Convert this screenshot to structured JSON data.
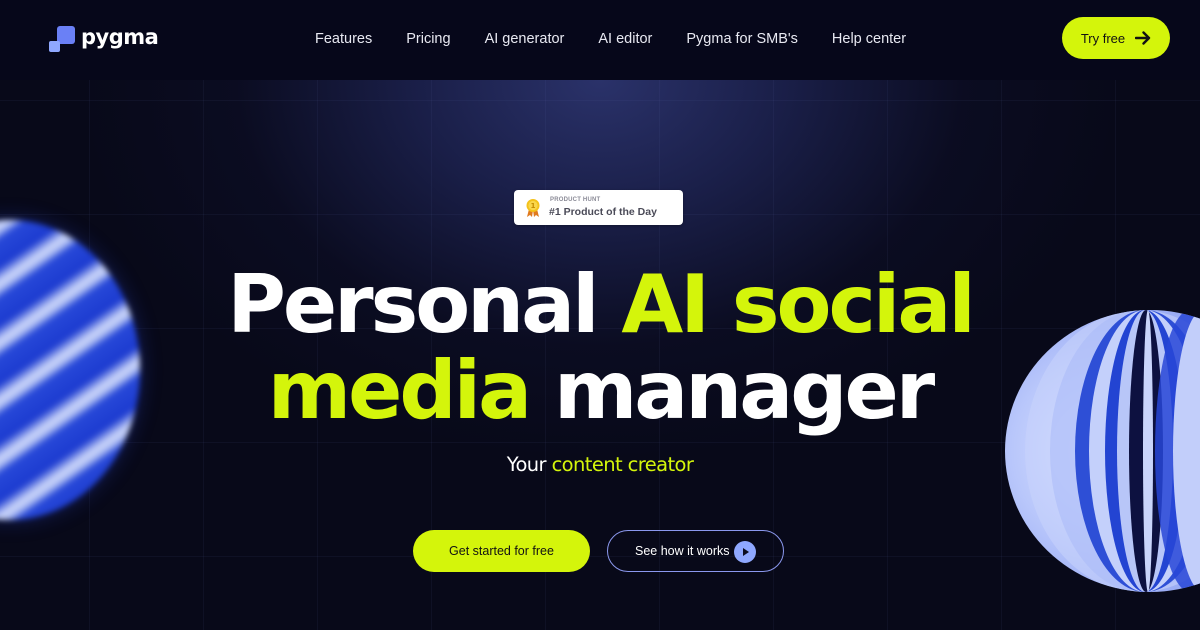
{
  "header": {
    "logo_text": "pygma",
    "nav": [
      {
        "label": "Features"
      },
      {
        "label": "Pricing"
      },
      {
        "label": "AI generator"
      },
      {
        "label": "AI editor"
      },
      {
        "label": "Pygma for SMB's"
      },
      {
        "label": "Help center"
      }
    ],
    "cta_label": "Try free",
    "cta_icon": "arrow-right-icon"
  },
  "badge": {
    "eyebrow": "PRODUCT HUNT",
    "title": "#1 Product of the Day",
    "icon": "medal-icon"
  },
  "hero": {
    "headline_line1_white": "Personal",
    "headline_line1_accent": "AI social",
    "headline_line2_accent": "media",
    "headline_line2_white": "manager",
    "subtitle_white": "Your",
    "subtitle_accent": "content creator",
    "primary_cta": "Get started for free",
    "secondary_cta": "See how it works",
    "secondary_cta_icon": "play-icon"
  },
  "colors": {
    "accent_lime": "#d4f50b",
    "brand_periwinkle": "#8fa8ff",
    "background": "#080919"
  }
}
